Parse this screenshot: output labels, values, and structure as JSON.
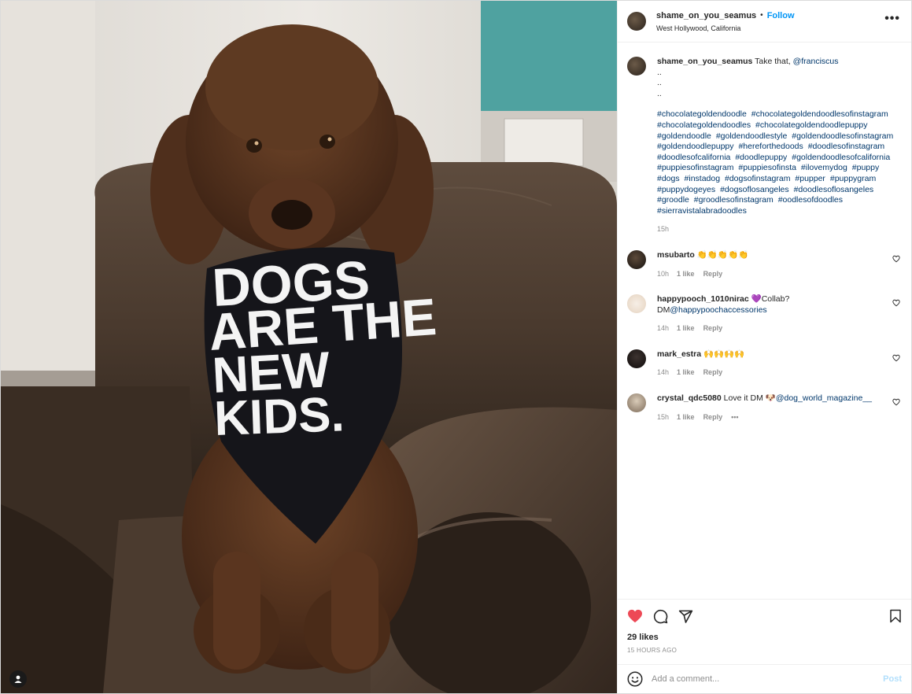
{
  "post": {
    "username": "shame_on_you_seamus",
    "follow_label": "Follow",
    "separator": "•",
    "location": "West Hollywood, California",
    "more_label": "•••",
    "bandana_text": [
      "DOGS",
      "ARE THE",
      "NEW",
      "KIDS."
    ]
  },
  "caption": {
    "username": "shame_on_you_seamus",
    "text": "Take that,",
    "mention": "@franciscus",
    "dot_lines": [
      "..",
      "..",
      ".."
    ],
    "hashtags": [
      "#chocolategoldendoodle",
      "#chocolategoldendoodlesofinstagram",
      "#chocolategoldendoodles",
      "#chocolategoldendoodlepuppy",
      "#goldendoodle",
      "#goldendoodlestyle",
      "#goldendoodlesofinstagram",
      "#goldendoodlepuppy",
      "#hereforthedoods",
      "#doodlesofinstagram",
      "#doodlesofcalifornia",
      "#doodlepuppy",
      "#goldendoodlesofcalifornia",
      "#puppiesofinstagram",
      "#puppiesofinsta",
      "#ilovemydog",
      "#puppy",
      "#dogs",
      "#instadog",
      "#dogsofinstagram",
      "#pupper",
      "#puppygram",
      "#puppydogeyes",
      "#dogsoflosangeles",
      "#doodlesoflosangeles",
      "#groodle",
      "#groodlesofinstagram",
      "#oodlesofdoodles",
      "#sierravistalabradoodles"
    ],
    "time": "15h"
  },
  "comments": [
    {
      "user": "msubarto",
      "text": "👏👏👏👏👏",
      "mention": "",
      "time": "10h",
      "likes": "1 like",
      "reply": "Reply",
      "more": ""
    },
    {
      "user": "happypooch_1010nirac",
      "text": "💜Collab? DM",
      "mention": "@happypoochaccessories",
      "time": "14h",
      "likes": "1 like",
      "reply": "Reply",
      "more": ""
    },
    {
      "user": "mark_estra",
      "text": "🙌🙌🙌🙌",
      "mention": "",
      "time": "14h",
      "likes": "1 like",
      "reply": "Reply",
      "more": ""
    },
    {
      "user": "crystal_qdc5080",
      "text": "Love it DM 🐶",
      "mention": "@dog_world_magazine__",
      "time": "15h",
      "likes": "1 like",
      "reply": "Reply",
      "more": "•••"
    }
  ],
  "footer": {
    "likes": "29 likes",
    "time_ago": "15 HOURS AGO",
    "comment_placeholder": "Add a comment...",
    "post_label": "Post"
  },
  "colors": {
    "accent": "#0095f6",
    "like_red": "#ed4956",
    "link": "#00376b",
    "muted": "#8e8e8e",
    "post_disabled": "#b2dffc"
  },
  "icons": [
    "heart-filled-icon",
    "comment-icon",
    "share-icon",
    "bookmark-icon",
    "emoji-icon",
    "more-icon",
    "tag-user-icon",
    "heart-outline-icon"
  ]
}
